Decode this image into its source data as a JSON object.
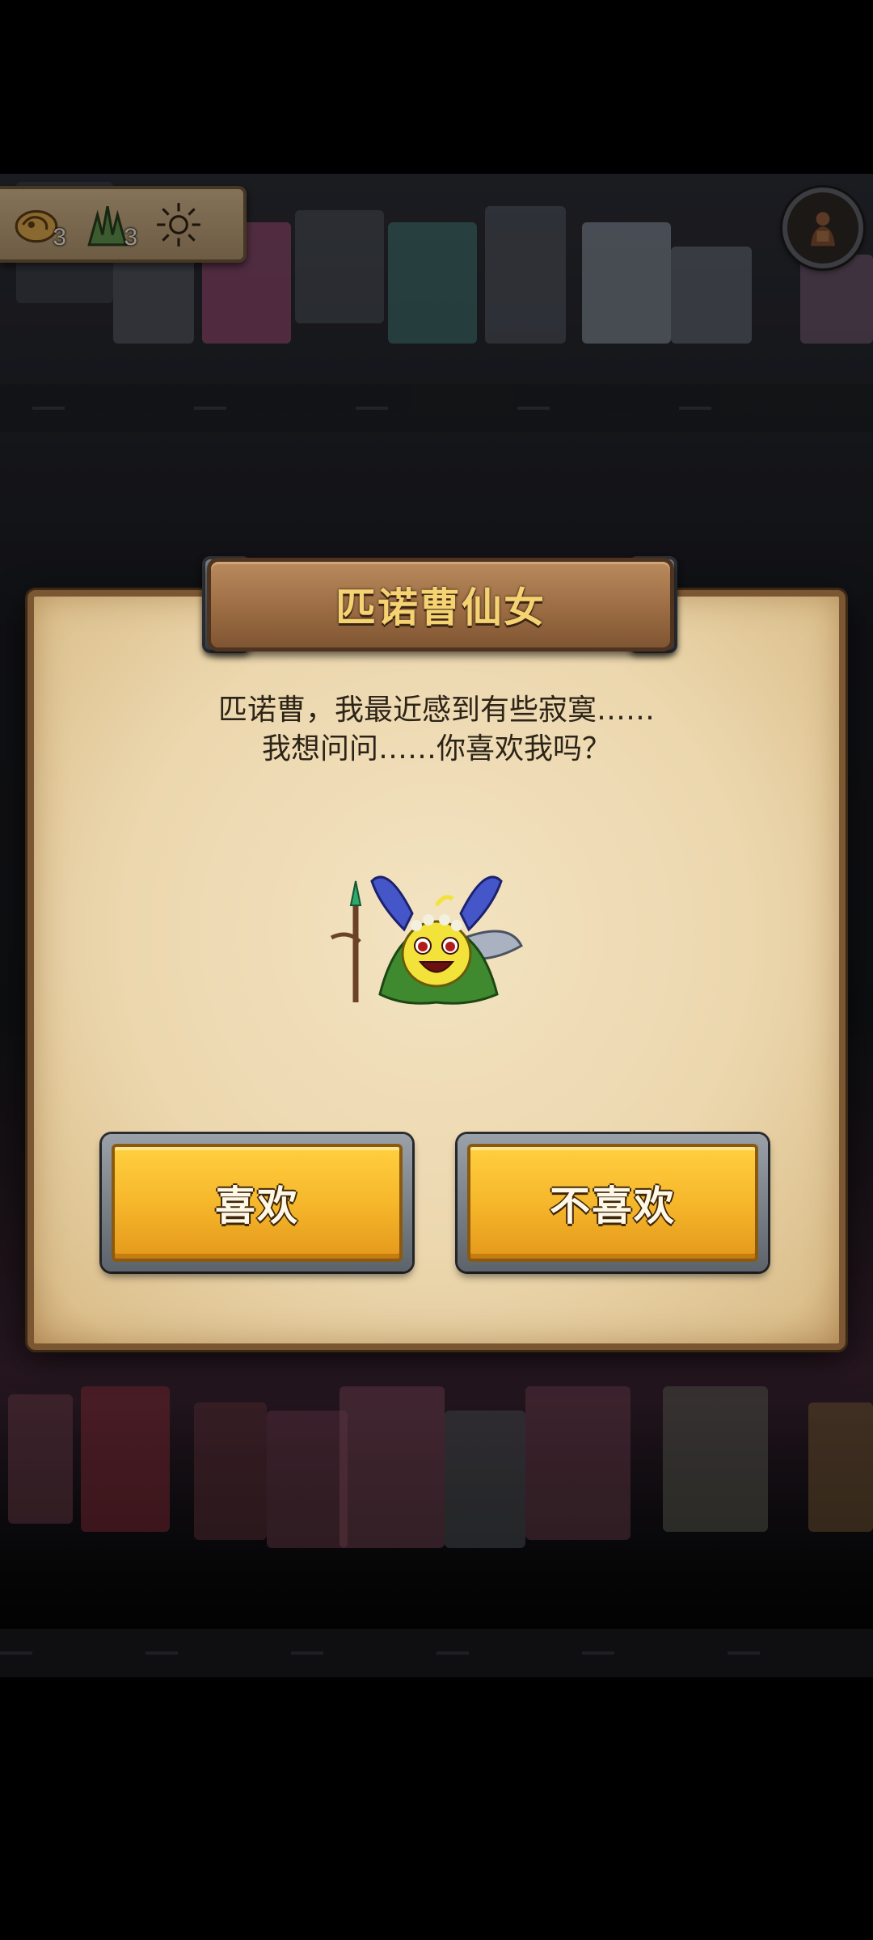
{
  "hud": {
    "resources": [
      {
        "icon": "fossil-icon",
        "count": "3"
      },
      {
        "icon": "grass-icon",
        "count": "3"
      },
      {
        "icon": "sun-icon",
        "count": ""
      }
    ],
    "avatar_icon": "player-avatar-icon"
  },
  "dialog": {
    "title": "匹诺曹仙女",
    "message_line1": "匹诺曹，我最近感到有些寂寞……",
    "message_line2": "我想问问……你喜欢我吗？",
    "character_icon": "fairy-creature-icon",
    "like_button": "喜欢",
    "dislike_button": "不喜欢"
  },
  "colors": {
    "parchment": "#ecd7ae",
    "button_gold": "#f6b72b",
    "title_text": "#f5d372"
  }
}
